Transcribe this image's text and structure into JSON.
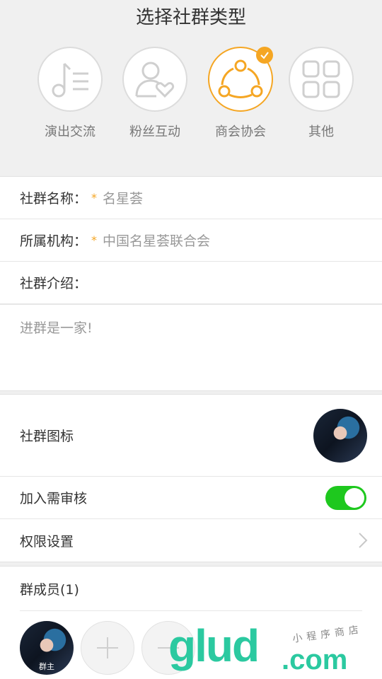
{
  "page": {
    "title": "选择社群类型"
  },
  "types": [
    {
      "label": "演出交流",
      "icon": "music-list-icon",
      "selected": false
    },
    {
      "label": "粉丝互动",
      "icon": "user-heart-icon",
      "selected": false
    },
    {
      "label": "商会协会",
      "icon": "share-nodes-icon",
      "selected": true
    },
    {
      "label": "其他",
      "icon": "grid-icon",
      "selected": false
    }
  ],
  "form": {
    "name_label": "社群名称：",
    "name_value": "名星荟",
    "org_label": "所属机构：",
    "org_value": "中国名星荟联合会",
    "required_mark": "*",
    "intro_label": "社群介绍：",
    "intro_value": "进群是一家!"
  },
  "settings": {
    "icon_label": "社群图标",
    "review_label": "加入需审核",
    "review_enabled": true,
    "permission_label": "权限设置"
  },
  "members": {
    "title": "群成员(1)",
    "owner_tag": "群主"
  },
  "watermark": {
    "brand": "glud",
    "domain": ".com",
    "tagline": "小程序商店"
  },
  "colors": {
    "accent": "#f5a623",
    "toggle_on": "#1ec81e",
    "watermark": "#2bc9a0"
  }
}
